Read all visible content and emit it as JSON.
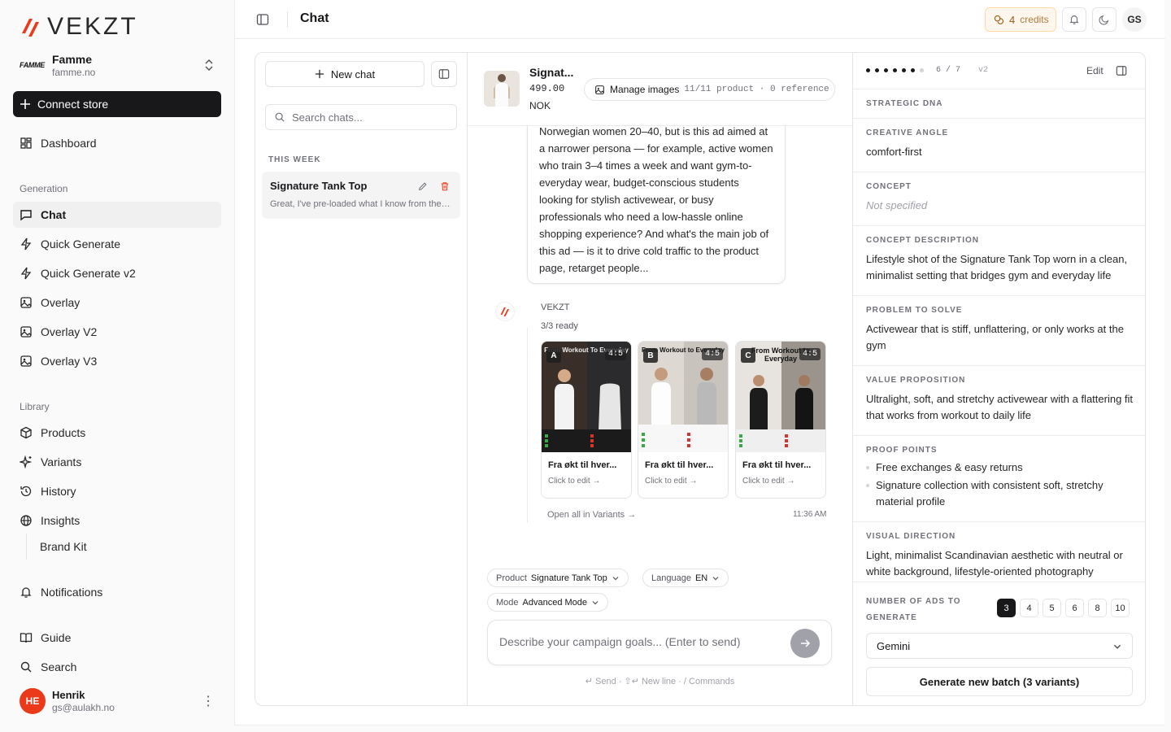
{
  "brand": {
    "logo_text": "VEKZT",
    "accent": "#ea3a1a"
  },
  "store": {
    "name": "Famme",
    "url": "famme.no",
    "logo_text": "FAMME"
  },
  "sidebar": {
    "connect_label": "Connect store",
    "dashboard": "Dashboard",
    "generation_label": "Generation",
    "generation": [
      "Chat",
      "Quick Generate",
      "Quick Generate v2",
      "Overlay",
      "Overlay V2",
      "Overlay V3"
    ],
    "library_label": "Library",
    "library": [
      "Products",
      "Variants",
      "History",
      "Insights"
    ],
    "brand_kit": "Brand Kit",
    "notifications": "Notifications",
    "guide": "Guide",
    "search": "Search"
  },
  "user": {
    "initials": "HE",
    "name": "Henrik",
    "email": "gs@aulakh.no"
  },
  "topbar": {
    "title": "Chat",
    "credits_count": "4",
    "credits_label": "credits",
    "user_initials": "GS"
  },
  "chatlist": {
    "new_chat": "New chat",
    "search_placeholder": "Search chats...",
    "section": "THIS WEEK",
    "items": [
      {
        "title": "Signature Tank Top",
        "snippet": "Great, I've pre-loaded what I know from the product page"
      }
    ]
  },
  "product": {
    "name": "Signat...",
    "price": "499.00",
    "currency": "NOK",
    "manage_label": "Manage images",
    "image_counts": "11/11 product · 0 reference"
  },
  "conversation": {
    "message_text": "Norwegian women 20–40, but is this ad aimed at a narrower persona — for example, active women who train 3–4 times a week and want gym-to-everyday wear, budget-conscious students looking for stylish activewear, or busy professionals who need a low-hassle online shopping experience? And what's the main job of this ad — is it to drive cold traffic to the product page, retarget people...",
    "bot_name": "VEKZT",
    "status": "3/3 ready",
    "variants": [
      {
        "letter": "A",
        "ratio": "4:5",
        "headline": "From Workout To Everyday",
        "title": "Fra økt til hver...",
        "edit": "Click to edit →"
      },
      {
        "letter": "B",
        "ratio": "4:5",
        "headline": "From Workout to Everyday",
        "title": "Fra økt til hver...",
        "edit": "Click to edit →"
      },
      {
        "letter": "C",
        "ratio": "4:5",
        "headline": "From Workout to Everyday",
        "title": "Fra økt til hver...",
        "edit": "Click to edit →"
      }
    ],
    "open_all": "Open all in Variants →",
    "time": "11:36 AM"
  },
  "composer": {
    "product_label": "Product",
    "product_value": "Signature Tank Top",
    "language_label": "Language",
    "language_value": "EN",
    "mode_label": "Mode",
    "mode_value": "Advanced Mode",
    "placeholder": "Describe your campaign goals... (Enter to send)",
    "hint": "↵ Send · ⇧↵ New line · / Commands"
  },
  "strategy": {
    "progress": "6 / 7",
    "version": "v2",
    "completed_steps": 6,
    "total_steps": 7,
    "edit": "Edit",
    "heading": "STRATEGIC DNA",
    "sections": [
      {
        "label": "CREATIVE ANGLE",
        "value": "comfort-first"
      },
      {
        "label": "CONCEPT",
        "value": "Not specified"
      },
      {
        "label": "CONCEPT DESCRIPTION",
        "value": "Lifestyle shot of the Signature Tank Top worn in a clean, minimalist setting that bridges gym and everyday life"
      },
      {
        "label": "PROBLEM TO SOLVE",
        "value": "Activewear that is stiff, unflattering, or only works at the gym"
      },
      {
        "label": "VALUE PROPOSITION",
        "value": "Ultralight, soft, and stretchy activewear with a flattering fit that works from workout to daily life"
      }
    ],
    "proof_label": "PROOF POINTS",
    "proof_points": [
      "Free exchanges & easy returns",
      "Signature collection with consistent soft, stretchy material profile"
    ],
    "visual_label": "VISUAL DIRECTION",
    "visual_value": "Light, minimalist Scandinavian aesthetic with neutral or white background, lifestyle-oriented photography",
    "num_label": "NUMBER OF ADS TO GENERATE",
    "num_options": [
      "3",
      "4",
      "5",
      "6",
      "8",
      "10"
    ],
    "num_selected": "3",
    "model": "Gemini",
    "generate": "Generate new batch (3 variants)"
  }
}
